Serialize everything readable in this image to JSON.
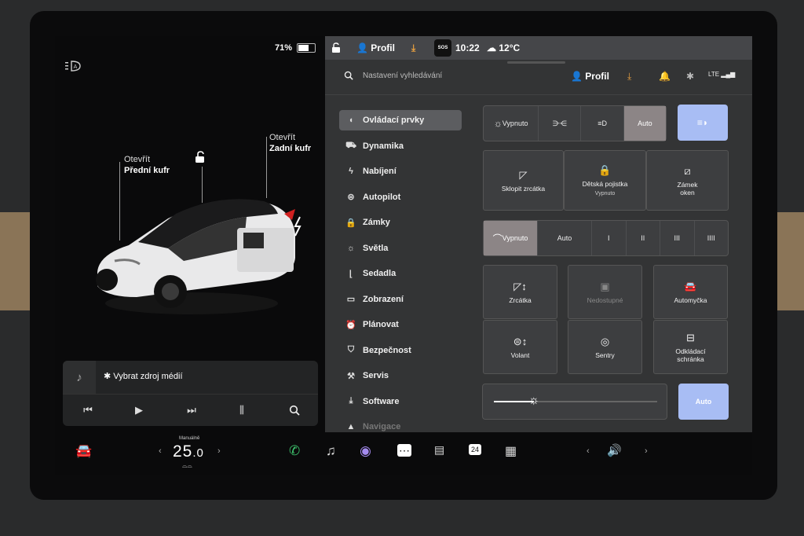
{
  "status": {
    "battery_percent": "71%",
    "battery_level": 0.71
  },
  "car_view": {
    "front_trunk": {
      "line1": "Otevřít",
      "line2": "Přední kufr"
    },
    "rear_trunk": {
      "line1": "Otevřít",
      "line2": "Zadní kufr"
    }
  },
  "media": {
    "source_label": "Vybrat zdroj médií"
  },
  "topbar": {
    "profile": "Profil",
    "sos": "SOS",
    "time": "10:22",
    "temperature": "12°C"
  },
  "header": {
    "search_placeholder": "Nastavení vyhledávání",
    "profile": "Profil",
    "lte": "LTE"
  },
  "menu": [
    {
      "label": "Ovládací prvky",
      "icon": "toggle-icon",
      "active": true
    },
    {
      "label": "Dynamika",
      "icon": "car-icon"
    },
    {
      "label": "Nabíjení",
      "icon": "bolt-icon"
    },
    {
      "label": "Autopilot",
      "icon": "steering-wheel-icon"
    },
    {
      "label": "Zámky",
      "icon": "lock-icon"
    },
    {
      "label": "Světla",
      "icon": "sun-icon"
    },
    {
      "label": "Sedadla",
      "icon": "seat-icon"
    },
    {
      "label": "Zobrazení",
      "icon": "display-icon"
    },
    {
      "label": "Plánovat",
      "icon": "alarm-clock-icon"
    },
    {
      "label": "Bezpečnost",
      "icon": "shield-icon"
    },
    {
      "label": "Servis",
      "icon": "wrench-icon"
    },
    {
      "label": "Software",
      "icon": "download-icon"
    },
    {
      "label": "Navigace",
      "icon": "navigation-icon"
    }
  ],
  "lights": {
    "off": "Vypnuto",
    "auto": "Auto",
    "selected": "Auto"
  },
  "controls": {
    "fold_mirrors": "Sklopit zrcátka",
    "child_lock": "Dětská pojistka",
    "child_lock_state": "Vypnuto",
    "window_lock_line1": "Zámek",
    "window_lock_line2": "oken"
  },
  "wipers": {
    "off": "Vypnuto",
    "auto": "Auto",
    "speeds": [
      "I",
      "II",
      "III",
      "IIII"
    ],
    "selected": "Vypnuto"
  },
  "tiles": {
    "mirrors": "Zrcátka",
    "unavailable": "Nedostupné",
    "car_wash": "Automyčka",
    "steering": "Volant",
    "sentry": "Sentry",
    "glovebox_line1": "Odkládací",
    "glovebox_line2": "schránka"
  },
  "brightness": {
    "auto": "Auto",
    "level": 0.33
  },
  "dock": {
    "drive_mode": "Manuálně",
    "temp_int": "25",
    "temp_dec": ".0",
    "calendar_day": "24"
  },
  "colors": {
    "accent_blue": "#a8bdf4",
    "selected_gray": "#8c8586",
    "download_orange": "#e8a040",
    "phone_green": "#3ec46d"
  }
}
